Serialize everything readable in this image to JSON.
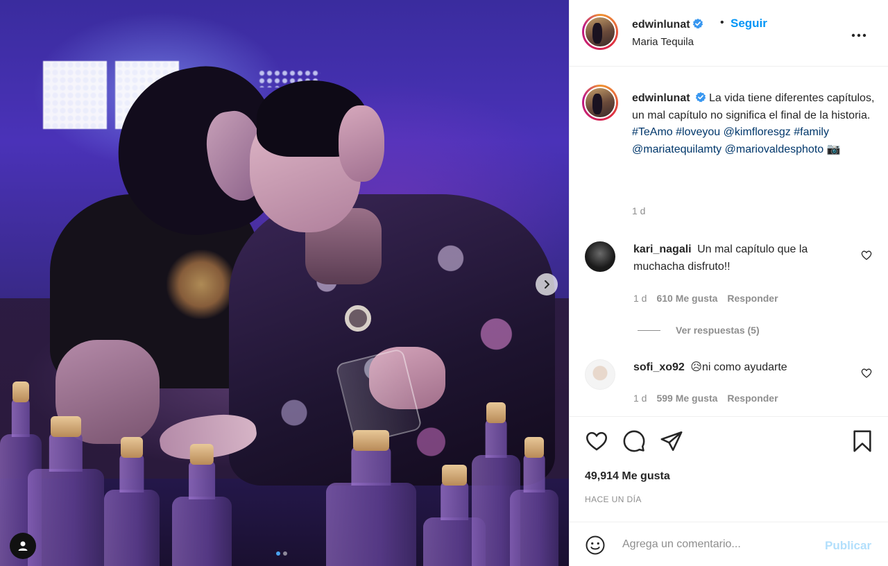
{
  "post": {
    "username": "edwinlunat",
    "follow_separator": "•",
    "follow_label": "Seguir",
    "location": "Maria Tequila",
    "more_label": "•••"
  },
  "caption": {
    "username": "edwinlunat",
    "text": "La vida tiene diferentes capítulos, un mal capítulo no significa el final de la historia.",
    "tags": [
      "#TeAmo",
      "#loveyou",
      "@kimfloresgz",
      "#family",
      "@mariatequilamty",
      "@mariovaldesphoto"
    ],
    "camera_emoji": "📷",
    "time": "1 d"
  },
  "comments": [
    {
      "username": "kari_nagali",
      "text": "Un mal capítulo que la muchacha disfruto!!",
      "time": "1 d",
      "likes": "610 Me gusta",
      "reply_label": "Responder",
      "view_replies": "Ver respuestas (5)"
    },
    {
      "username": "sofi_xo92",
      "emoji": "😥",
      "text": "ni como ayudarte",
      "time": "1 d",
      "likes": "599 Me gusta",
      "reply_label": "Responder"
    }
  ],
  "actions": {
    "likes": "49,914 Me gusta",
    "date": "HACE UN DÍA"
  },
  "composer": {
    "placeholder": "Agrega un comentario...",
    "publish_label": "Publicar"
  },
  "carousel": {
    "count": 2,
    "active_index": 1
  },
  "icons": [
    "verified-icon",
    "more-icon",
    "heart-icon",
    "comment-icon",
    "share-icon",
    "bookmark-icon",
    "emoji-icon",
    "chevron-right-icon",
    "user-tag-icon"
  ],
  "colors": {
    "accent": "#0095f6",
    "link": "#00376b",
    "muted": "#8e8e8e",
    "publish_disabled": "#b2dffc"
  }
}
